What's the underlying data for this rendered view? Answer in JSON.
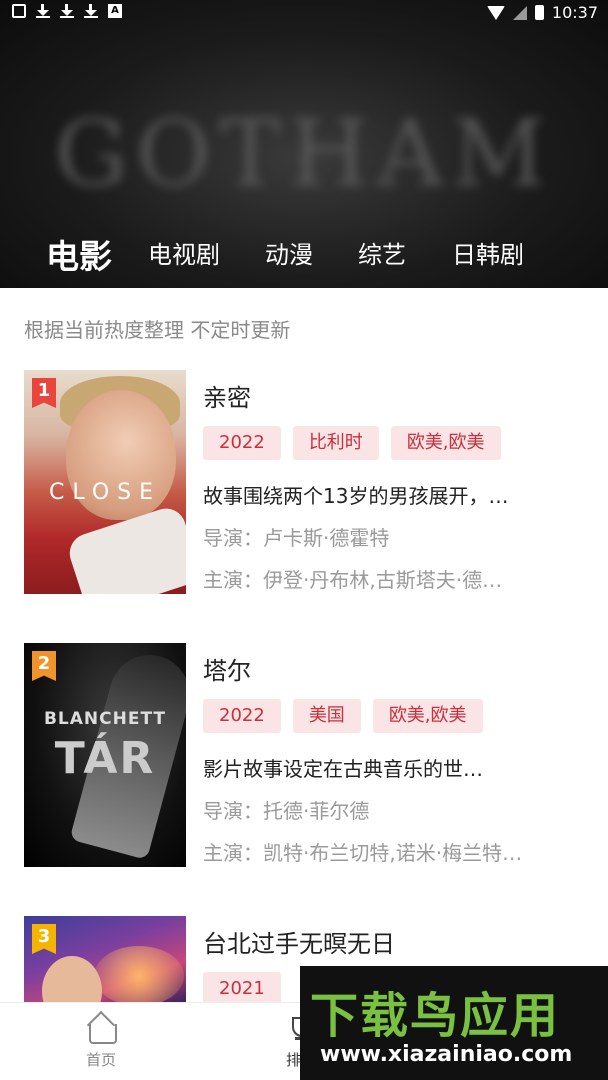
{
  "status_bar": {
    "time": "10:37"
  },
  "hero": {
    "background_word": "GOTHAM"
  },
  "tabs": [
    {
      "label": "电影",
      "active": true
    },
    {
      "label": "电视剧",
      "active": false
    },
    {
      "label": "动漫",
      "active": false
    },
    {
      "label": "综艺",
      "active": false
    },
    {
      "label": "日韩剧",
      "active": false
    }
  ],
  "subtitle": "根据当前热度整理 不定时更新",
  "items": [
    {
      "rank": "1",
      "rank_color": "#e8453c",
      "poster_text": "CLOSE",
      "title": "亲密",
      "tags": [
        "2022",
        "比利时",
        "欧美,欧美"
      ],
      "desc": "故事围绕两个13岁的男孩展开，…",
      "director": "导演：卢卡斯·德霍特",
      "cast": "主演：伊登·丹布林,古斯塔夫·德…"
    },
    {
      "rank": "2",
      "rank_color": "#f0932b",
      "poster_name": "BLANCHETT",
      "poster_text": "TÁR",
      "title": "塔尔",
      "tags": [
        "2022",
        "美国",
        "欧美,欧美"
      ],
      "desc": "影片故事设定在古典音乐的世…",
      "director": "导演：托德·菲尔德",
      "cast": "主演：凯特·布兰切特,诺米·梅兰特…"
    },
    {
      "rank": "3",
      "rank_color": "#f5b400",
      "title": "台北过手无暝无日",
      "tags": [
        "2021"
      ]
    }
  ],
  "bottom_nav": [
    {
      "label": "首页",
      "icon": "home-icon"
    },
    {
      "label": "排行",
      "icon": "trophy-icon"
    }
  ],
  "watermark": {
    "title": "下载鸟应用",
    "url": "www.xiazainiao.com"
  }
}
